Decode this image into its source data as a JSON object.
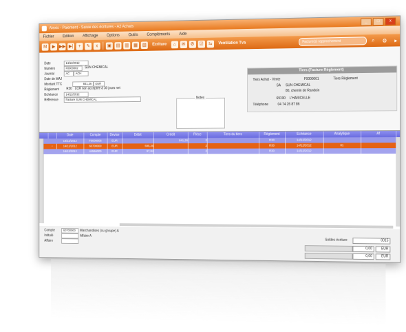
{
  "window": {
    "title": "Alexis - Paiement - Saisie des écritures - A2 Achats",
    "buttons": [
      "_",
      "□",
      "x"
    ]
  },
  "menu": [
    "Fichier",
    "Edition",
    "Affichage",
    "Options",
    "Outils",
    "Compléments",
    "Aide"
  ],
  "toolbar": {
    "icons": [
      "M",
      "▶",
      "▶▶",
      "▶|",
      "+",
      "✎",
      "x",
      "▣",
      "▤",
      "▥",
      "▦",
      "▧",
      "▨",
      "⌂",
      "✉",
      "⚙",
      "☑",
      "⇆",
      "☷",
      "✆"
    ],
    "ecriture_label": "Ecriture",
    "vent_label": "Ventilation Tva",
    "search_placeholder": "Facture(s) rapprochement",
    "right_icons": [
      "⌕",
      "⚙",
      "▸"
    ]
  },
  "form": {
    "labels": [
      "Date",
      "Numéro",
      "Journal",
      "Date de MAJ",
      "Montant TTC",
      "Règlement",
      "Echéance",
      "Référence"
    ],
    "date": "14/12/2012",
    "numero": "F0000002",
    "numero_tier": "SUN CHEMICAL",
    "journal": "AC",
    "journal_code": "ACH",
    "montant": "841,26",
    "devise": "EUR",
    "reglement": "R30",
    "reglement_text": "LCR non acceptée à 30 jours net",
    "echeance": "14/12/2012",
    "reference": "Facture SUN CHEMICAL"
  },
  "notes": {
    "title": "Notes"
  },
  "tiers": {
    "header": "Tiers (Facture Règlement)",
    "type": "Tiers Achat - Vente",
    "code": "F0000001",
    "reg_label": "Tiers Règlement",
    "sa": "SA",
    "name": "SUN CHEMICAL",
    "address": "80, chemin de Randoin",
    "cp": "69190",
    "city": "L'HARICELLE",
    "phone_label": "Téléphone",
    "phone": "04 74 26 87 86"
  },
  "grid": {
    "headers": [
      "",
      "",
      "Date",
      "Compte",
      "Devise",
      "Débit",
      "Crédit",
      "Pièce",
      "Tiers du tiers",
      "Règlement",
      "Echéance",
      "Analytique",
      "Af"
    ],
    "rows": [
      {
        "date": "14/12/2012",
        "compte": "F0000006",
        "devise": "EUR",
        "debit": "",
        "credit": "841,26",
        "piece": "2",
        "tiers": "",
        "reglement": "R30",
        "echeance": "14/12/2012",
        "analytique": ""
      },
      {
        "date": "14/12/2012",
        "compte": "60700000",
        "devise": "EUR",
        "debit": "695,26",
        "credit": "",
        "piece": "2",
        "tiers": "",
        "reglement": "R30",
        "echeance": "14/12/2012",
        "analytique": "01"
      },
      {
        "date": "14/12/2012",
        "compte": "44566000",
        "devise": "EUR",
        "debit": "97,84",
        "credit": "",
        "piece": "2",
        "tiers": "",
        "reglement": "R30",
        "echeance": "14/12/2012",
        "analytique": ""
      }
    ]
  },
  "footer": {
    "labels": [
      "Compte",
      "Intitulé",
      "Affaire"
    ],
    "compte": "60700000",
    "intitule": "Marchandises (ou groupe) A",
    "affaire": "Affaire A",
    "solde_label": "Soldes écriture",
    "solde_value": "0015",
    "total1": "0,00",
    "total1_cur": "EUR",
    "total2": "0,00",
    "total2_cur": "EUR"
  }
}
